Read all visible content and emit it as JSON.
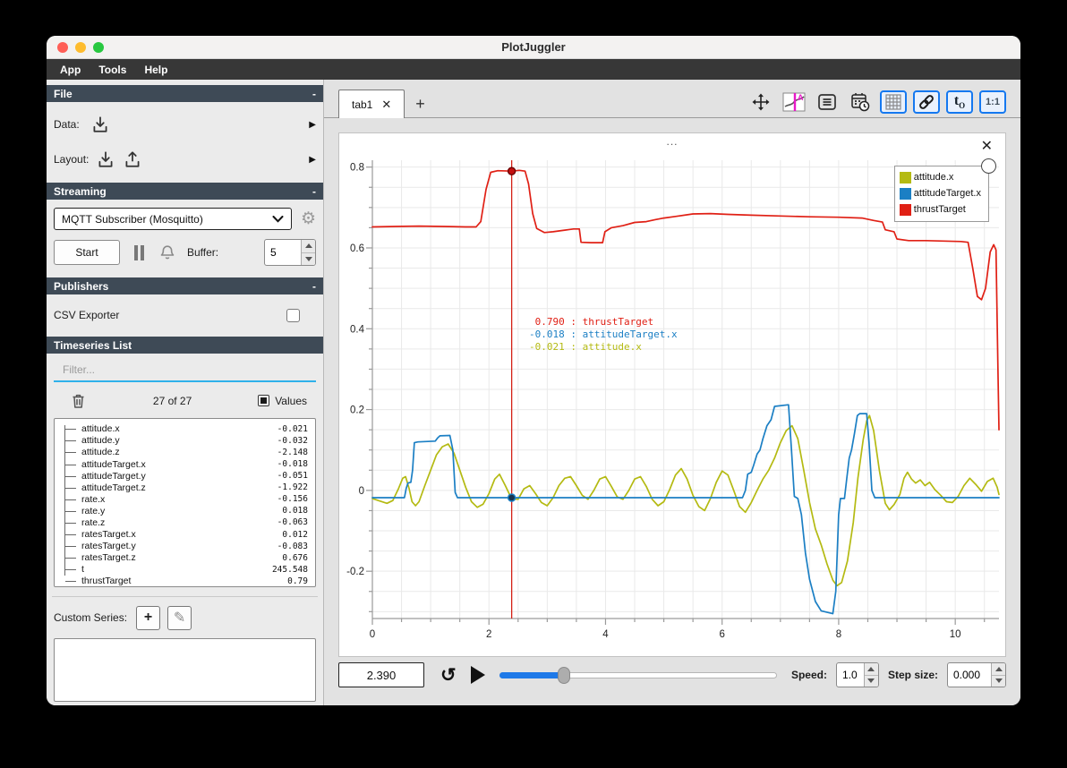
{
  "window": {
    "title": "PlotJuggler"
  },
  "menubar": {
    "items": [
      "App",
      "Tools",
      "Help"
    ]
  },
  "icons": {
    "collapse": "-",
    "submenu": "▶",
    "close": "✕",
    "plus": "+",
    "pencil": "✎",
    "gear": "⚙",
    "loop": "↺",
    "ratio": "1:1",
    "t": "t",
    "t_sub": "O",
    "dots": "..."
  },
  "sidebar": {
    "file": {
      "header": "File",
      "data_label": "Data:",
      "layout_label": "Layout:"
    },
    "streaming": {
      "header": "Streaming",
      "source": "MQTT Subscriber (Mosquitto)",
      "start_label": "Start",
      "buffer_label": "Buffer:",
      "buffer_value": "5"
    },
    "publishers": {
      "header": "Publishers",
      "csv_label": "CSV Exporter"
    },
    "timeseries": {
      "header": "Timeseries List",
      "filter_placeholder": "Filter...",
      "count": "27 of 27",
      "values_label": "Values",
      "items": [
        {
          "name": "attitude.x",
          "value": "-0.021"
        },
        {
          "name": "attitude.y",
          "value": "-0.032"
        },
        {
          "name": "attitude.z",
          "value": "-2.148"
        },
        {
          "name": "attitudeTarget.x",
          "value": "-0.018"
        },
        {
          "name": "attitudeTarget.y",
          "value": "-0.051"
        },
        {
          "name": "attitudeTarget.z",
          "value": "-1.922"
        },
        {
          "name": "rate.x",
          "value": "-0.156"
        },
        {
          "name": "rate.y",
          "value": "0.018"
        },
        {
          "name": "rate.z",
          "value": "-0.063"
        },
        {
          "name": "ratesTarget.x",
          "value": "0.012"
        },
        {
          "name": "ratesTarget.y",
          "value": "-0.083"
        },
        {
          "name": "ratesTarget.z",
          "value": "0.676"
        },
        {
          "name": "t",
          "value": "245.548"
        },
        {
          "name": "thrustTarget",
          "value": "0.79"
        }
      ]
    },
    "custom_series": {
      "label": "Custom Series:"
    }
  },
  "main": {
    "tab": {
      "label": "tab1"
    },
    "plot": {
      "tooltip": {
        "lines": [
          {
            "value": " 0.790",
            "name": "thrustTarget",
            "color": "#e02015"
          },
          {
            "value": "-0.018",
            "name": "attitudeTarget.x",
            "color": "#1b7fc4"
          },
          {
            "value": "-0.021",
            "name": "attitude.x",
            "color": "#b4ba12"
          }
        ]
      }
    },
    "transport": {
      "time_value": "2.390",
      "slider_fraction": 0.234,
      "speed_label": "Speed:",
      "speed_value": "1.0",
      "step_label": "Step size:",
      "step_value": "0.000"
    }
  },
  "chart_data": {
    "type": "line",
    "title": "",
    "xlabel": "",
    "ylabel": "",
    "xlim": [
      0,
      10.75
    ],
    "ylim": [
      -0.317,
      0.817
    ],
    "xticks": [
      0,
      2,
      4,
      6,
      8,
      10
    ],
    "yticks": [
      0.8,
      0.6,
      0.4,
      0.2,
      0,
      -0.2
    ],
    "grid": {
      "x_step": 0.5,
      "y_step": 0.05,
      "color": "#e9e9e9"
    },
    "legend_position": "top-right",
    "cursor": {
      "t": 2.39,
      "color": "#d42015",
      "markers": [
        {
          "value": 0.79,
          "fill": "#c40f0f",
          "stroke": "#6e0404"
        },
        {
          "value": -0.018,
          "fill": "#17344e",
          "stroke": "#1b7fc4"
        }
      ]
    },
    "series": [
      {
        "name": "attitude.x",
        "color": "#b4ba12",
        "points": [
          [
            0,
            -0.02
          ],
          [
            0.12,
            -0.026
          ],
          [
            0.25,
            -0.032
          ],
          [
            0.35,
            -0.025
          ],
          [
            0.45,
            0.005
          ],
          [
            0.52,
            0.03
          ],
          [
            0.57,
            0.034
          ],
          [
            0.63,
            0.005
          ],
          [
            0.68,
            -0.028
          ],
          [
            0.74,
            -0.038
          ],
          [
            0.8,
            -0.028
          ],
          [
            0.9,
            0.012
          ],
          [
            1.0,
            0.05
          ],
          [
            1.1,
            0.088
          ],
          [
            1.2,
            0.108
          ],
          [
            1.3,
            0.115
          ],
          [
            1.4,
            0.092
          ],
          [
            1.5,
            0.05
          ],
          [
            1.6,
            0.008
          ],
          [
            1.7,
            -0.028
          ],
          [
            1.8,
            -0.042
          ],
          [
            1.9,
            -0.034
          ],
          [
            2.0,
            -0.008
          ],
          [
            2.1,
            0.028
          ],
          [
            2.18,
            0.04
          ],
          [
            2.28,
            0.012
          ],
          [
            2.39,
            -0.021
          ],
          [
            2.5,
            -0.022
          ],
          [
            2.6,
            0.004
          ],
          [
            2.7,
            0.012
          ],
          [
            2.8,
            -0.008
          ],
          [
            2.9,
            -0.03
          ],
          [
            3.0,
            -0.038
          ],
          [
            3.1,
            -0.018
          ],
          [
            3.2,
            0.012
          ],
          [
            3.3,
            0.03
          ],
          [
            3.4,
            0.034
          ],
          [
            3.5,
            0.012
          ],
          [
            3.6,
            -0.012
          ],
          [
            3.7,
            -0.022
          ],
          [
            3.8,
            0.0
          ],
          [
            3.9,
            0.028
          ],
          [
            4.0,
            0.034
          ],
          [
            4.1,
            0.01
          ],
          [
            4.2,
            -0.016
          ],
          [
            4.3,
            -0.022
          ],
          [
            4.4,
            0.0
          ],
          [
            4.5,
            0.028
          ],
          [
            4.6,
            0.034
          ],
          [
            4.7,
            0.01
          ],
          [
            4.8,
            -0.022
          ],
          [
            4.9,
            -0.038
          ],
          [
            5.0,
            -0.028
          ],
          [
            5.1,
            0.002
          ],
          [
            5.2,
            0.038
          ],
          [
            5.3,
            0.054
          ],
          [
            5.4,
            0.028
          ],
          [
            5.5,
            -0.012
          ],
          [
            5.6,
            -0.04
          ],
          [
            5.7,
            -0.05
          ],
          [
            5.8,
            -0.02
          ],
          [
            5.9,
            0.02
          ],
          [
            6.0,
            0.048
          ],
          [
            6.1,
            0.038
          ],
          [
            6.2,
            0.0
          ],
          [
            6.3,
            -0.04
          ],
          [
            6.4,
            -0.054
          ],
          [
            6.5,
            -0.03
          ],
          [
            6.6,
            0.0
          ],
          [
            6.7,
            0.028
          ],
          [
            6.8,
            0.05
          ],
          [
            6.9,
            0.08
          ],
          [
            7.0,
            0.118
          ],
          [
            7.1,
            0.148
          ],
          [
            7.2,
            0.16
          ],
          [
            7.3,
            0.128
          ],
          [
            7.4,
            0.05
          ],
          [
            7.5,
            -0.03
          ],
          [
            7.6,
            -0.095
          ],
          [
            7.7,
            -0.135
          ],
          [
            7.8,
            -0.182
          ],
          [
            7.9,
            -0.222
          ],
          [
            7.97,
            -0.236
          ],
          [
            8.05,
            -0.228
          ],
          [
            8.15,
            -0.175
          ],
          [
            8.25,
            -0.08
          ],
          [
            8.33,
            0.03
          ],
          [
            8.42,
            0.125
          ],
          [
            8.48,
            0.172
          ],
          [
            8.53,
            0.185
          ],
          [
            8.6,
            0.148
          ],
          [
            8.7,
            0.048
          ],
          [
            8.8,
            -0.032
          ],
          [
            8.87,
            -0.048
          ],
          [
            8.95,
            -0.035
          ],
          [
            9.05,
            -0.01
          ],
          [
            9.12,
            0.03
          ],
          [
            9.18,
            0.045
          ],
          [
            9.25,
            0.028
          ],
          [
            9.32,
            0.018
          ],
          [
            9.4,
            0.026
          ],
          [
            9.48,
            0.012
          ],
          [
            9.56,
            0.02
          ],
          [
            9.65,
            0.002
          ],
          [
            9.75,
            -0.012
          ],
          [
            9.85,
            -0.028
          ],
          [
            9.95,
            -0.03
          ],
          [
            10.05,
            -0.015
          ],
          [
            10.15,
            0.012
          ],
          [
            10.25,
            0.03
          ],
          [
            10.35,
            0.015
          ],
          [
            10.45,
            -0.002
          ],
          [
            10.55,
            0.022
          ],
          [
            10.65,
            0.03
          ],
          [
            10.72,
            0.008
          ],
          [
            10.75,
            -0.01
          ]
        ]
      },
      {
        "name": "attitudeTarget.x",
        "color": "#1b7fc4",
        "points": [
          [
            0,
            -0.018
          ],
          [
            0.55,
            -0.018
          ],
          [
            0.58,
            0.005
          ],
          [
            0.61,
            0.018
          ],
          [
            0.66,
            0.02
          ],
          [
            0.69,
            0.05
          ],
          [
            0.72,
            0.118
          ],
          [
            0.78,
            0.12
          ],
          [
            1.08,
            0.122
          ],
          [
            1.12,
            0.13
          ],
          [
            1.16,
            0.135
          ],
          [
            1.33,
            0.136
          ],
          [
            1.38,
            0.1
          ],
          [
            1.42,
            -0.005
          ],
          [
            1.46,
            -0.018
          ],
          [
            6.35,
            -0.018
          ],
          [
            6.4,
            0.0
          ],
          [
            6.44,
            0.04
          ],
          [
            6.5,
            0.045
          ],
          [
            6.54,
            0.062
          ],
          [
            6.6,
            0.09
          ],
          [
            6.65,
            0.1
          ],
          [
            6.7,
            0.128
          ],
          [
            6.77,
            0.16
          ],
          [
            6.84,
            0.175
          ],
          [
            6.9,
            0.208
          ],
          [
            7.14,
            0.212
          ],
          [
            7.19,
            0.1
          ],
          [
            7.24,
            -0.015
          ],
          [
            7.3,
            -0.02
          ],
          [
            7.36,
            -0.06
          ],
          [
            7.43,
            -0.155
          ],
          [
            7.5,
            -0.22
          ],
          [
            7.6,
            -0.275
          ],
          [
            7.7,
            -0.298
          ],
          [
            7.9,
            -0.305
          ],
          [
            7.95,
            -0.25
          ],
          [
            8.0,
            -0.06
          ],
          [
            8.03,
            -0.02
          ],
          [
            8.1,
            -0.02
          ],
          [
            8.14,
            0.03
          ],
          [
            8.18,
            0.08
          ],
          [
            8.22,
            0.1
          ],
          [
            8.27,
            0.14
          ],
          [
            8.32,
            0.185
          ],
          [
            8.36,
            0.19
          ],
          [
            8.48,
            0.19
          ],
          [
            8.52,
            0.12
          ],
          [
            8.57,
            0.0
          ],
          [
            8.62,
            -0.018
          ],
          [
            10.75,
            -0.018
          ]
        ]
      },
      {
        "name": "thrustTarget",
        "color": "#e02015",
        "points": [
          [
            0,
            0.652
          ],
          [
            0.4,
            0.653
          ],
          [
            0.8,
            0.654
          ],
          [
            1.2,
            0.653
          ],
          [
            1.6,
            0.652
          ],
          [
            1.78,
            0.652
          ],
          [
            1.86,
            0.665
          ],
          [
            1.95,
            0.745
          ],
          [
            2.03,
            0.787
          ],
          [
            2.15,
            0.791
          ],
          [
            2.39,
            0.79
          ],
          [
            2.52,
            0.792
          ],
          [
            2.62,
            0.79
          ],
          [
            2.68,
            0.758
          ],
          [
            2.75,
            0.685
          ],
          [
            2.82,
            0.648
          ],
          [
            2.95,
            0.638
          ],
          [
            3.1,
            0.64
          ],
          [
            3.3,
            0.644
          ],
          [
            3.45,
            0.647
          ],
          [
            3.55,
            0.647
          ],
          [
            3.58,
            0.614
          ],
          [
            3.75,
            0.613
          ],
          [
            3.95,
            0.613
          ],
          [
            3.99,
            0.64
          ],
          [
            4.1,
            0.65
          ],
          [
            4.3,
            0.655
          ],
          [
            4.5,
            0.663
          ],
          [
            4.7,
            0.665
          ],
          [
            4.85,
            0.67
          ],
          [
            5.0,
            0.674
          ],
          [
            5.2,
            0.678
          ],
          [
            5.5,
            0.684
          ],
          [
            5.8,
            0.685
          ],
          [
            6.1,
            0.683
          ],
          [
            6.5,
            0.681
          ],
          [
            7.0,
            0.679
          ],
          [
            7.5,
            0.677
          ],
          [
            8.0,
            0.676
          ],
          [
            8.4,
            0.674
          ],
          [
            8.6,
            0.668
          ],
          [
            8.75,
            0.664
          ],
          [
            8.8,
            0.645
          ],
          [
            8.95,
            0.64
          ],
          [
            9.0,
            0.622
          ],
          [
            9.2,
            0.618
          ],
          [
            9.5,
            0.618
          ],
          [
            9.8,
            0.617
          ],
          [
            10.1,
            0.616
          ],
          [
            10.22,
            0.614
          ],
          [
            10.3,
            0.55
          ],
          [
            10.38,
            0.48
          ],
          [
            10.45,
            0.472
          ],
          [
            10.52,
            0.5
          ],
          [
            10.6,
            0.59
          ],
          [
            10.66,
            0.608
          ],
          [
            10.7,
            0.595
          ],
          [
            10.73,
            0.32
          ],
          [
            10.75,
            0.15
          ]
        ]
      }
    ]
  }
}
